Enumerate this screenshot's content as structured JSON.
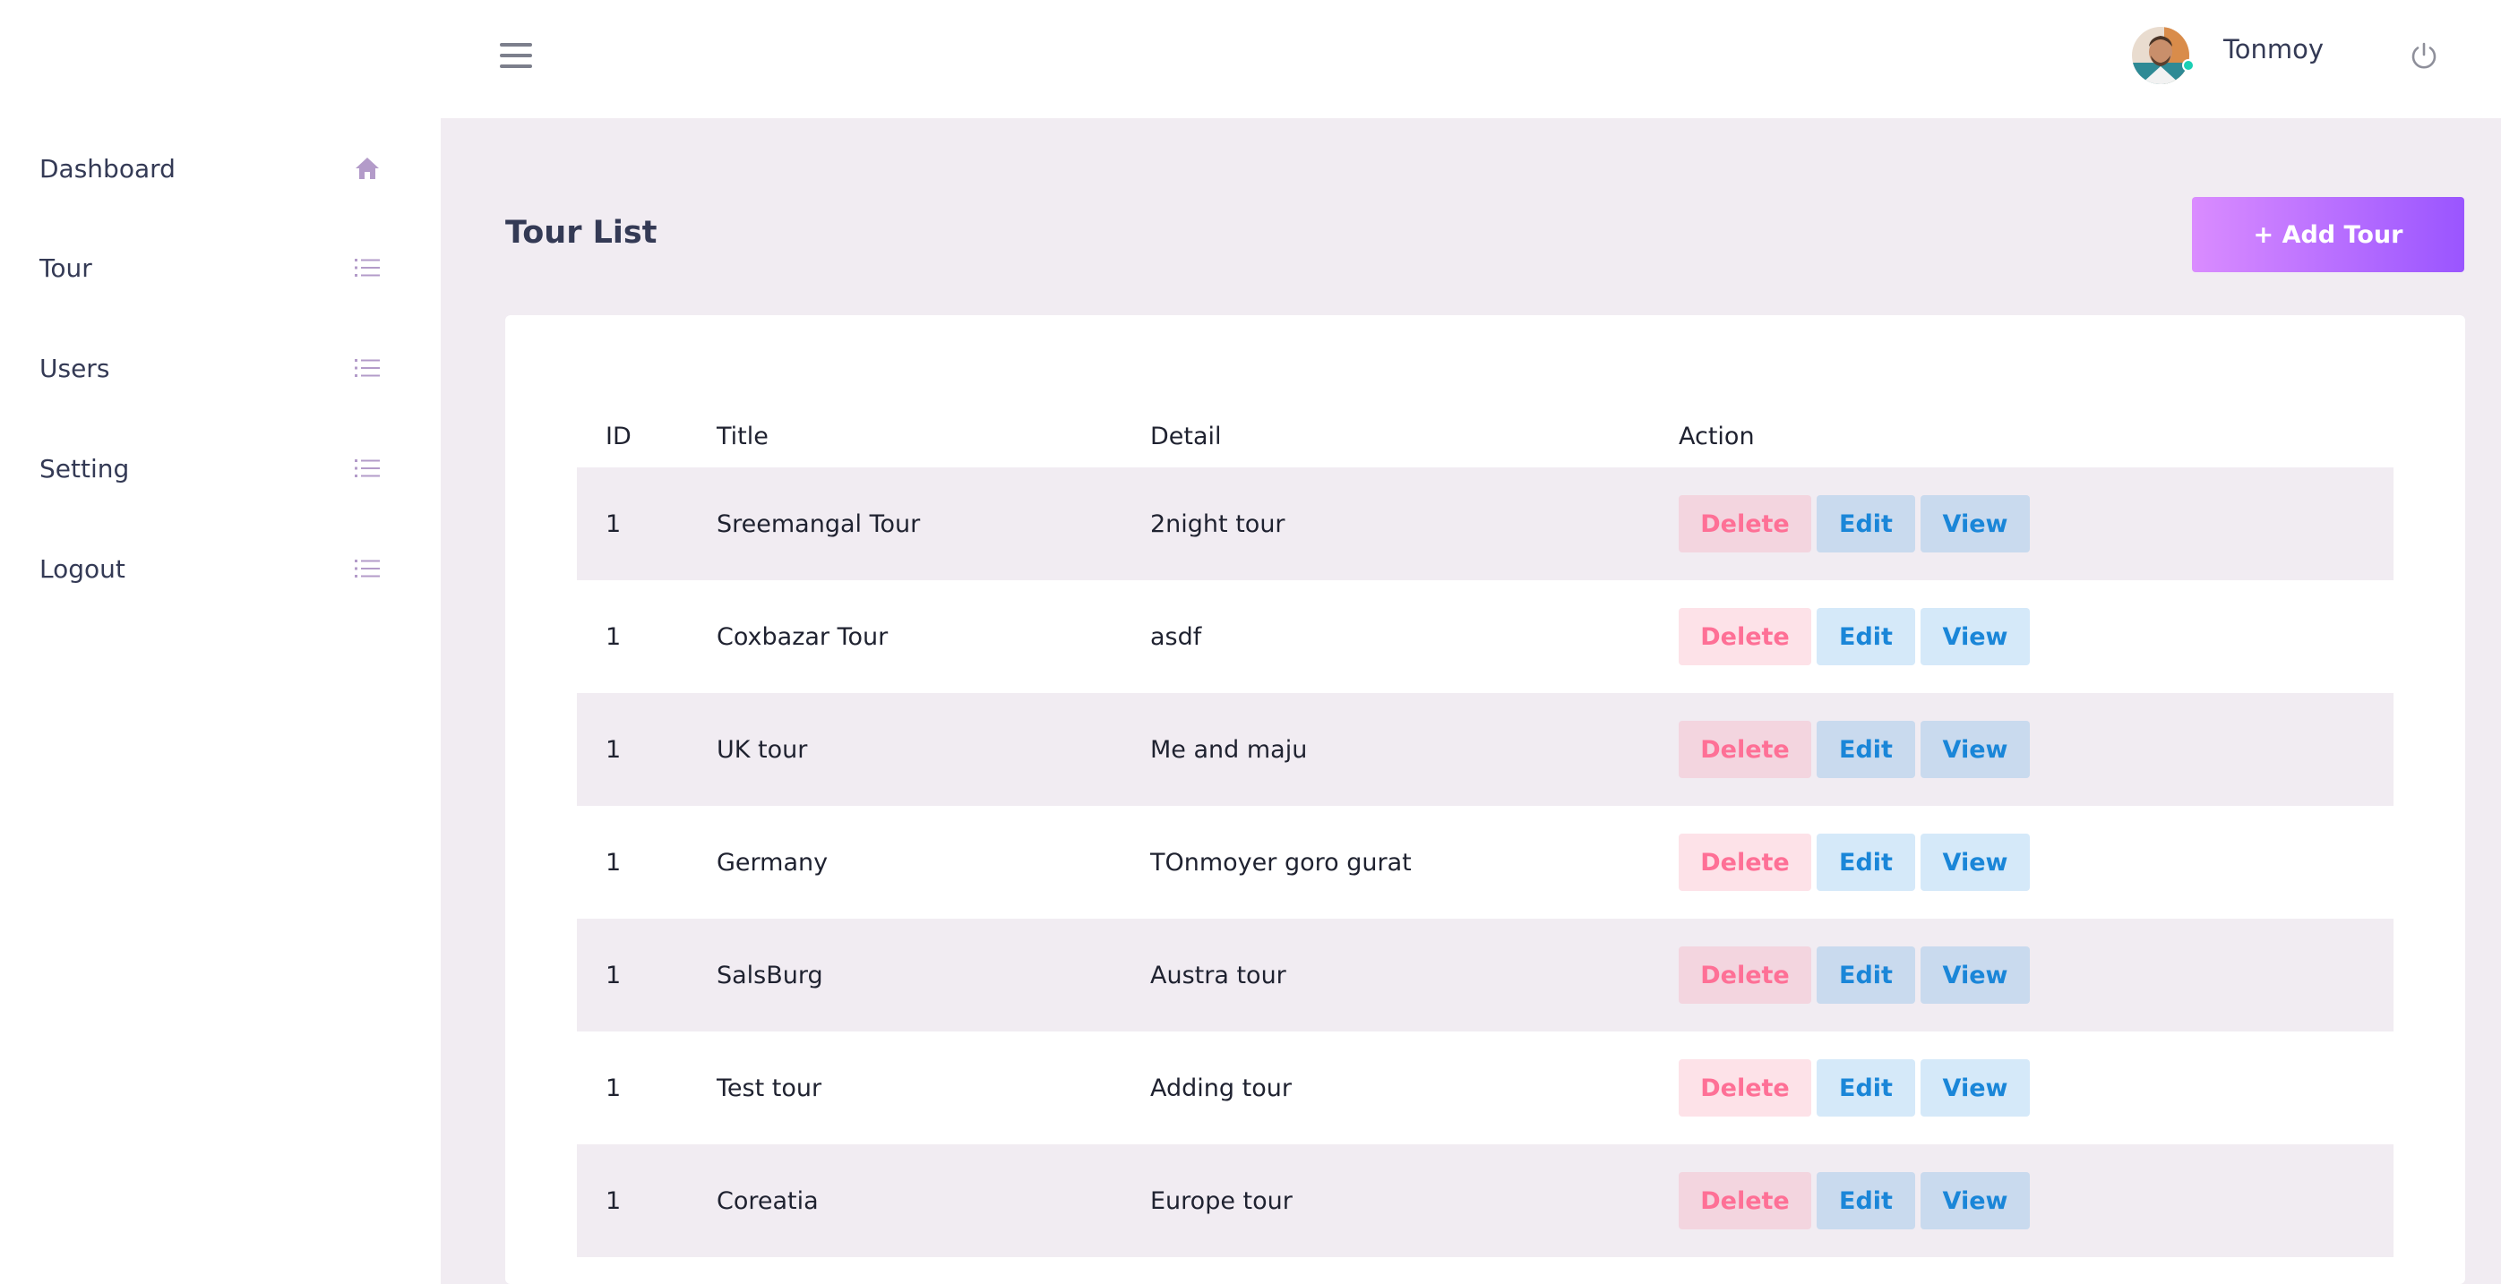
{
  "sidebar": {
    "items": [
      {
        "label": "Dashboard",
        "icon": "home-icon"
      },
      {
        "label": "Tour",
        "icon": "list-icon"
      },
      {
        "label": "Users",
        "icon": "list-icon"
      },
      {
        "label": "Setting",
        "icon": "list-icon"
      },
      {
        "label": "Logout",
        "icon": "list-icon"
      }
    ]
  },
  "topbar": {
    "user_name": "Tonmoy",
    "status_color": "#1bcfb4"
  },
  "page": {
    "title": "Tour List",
    "add_button_label": "+ Add Tour"
  },
  "table": {
    "headers": {
      "id": "ID",
      "title": "Title",
      "detail": "Detail",
      "action": "Action"
    },
    "action_labels": {
      "delete": "Delete",
      "edit": "Edit",
      "view": "View"
    },
    "rows": [
      {
        "id": "1",
        "title": "Sreemangal Tour",
        "detail": "2night tour"
      },
      {
        "id": "1",
        "title": "Coxbazar Tour",
        "detail": "asdf"
      },
      {
        "id": "1",
        "title": "UK tour",
        "detail": "Me and maju"
      },
      {
        "id": "1",
        "title": "Germany",
        "detail": "TOnmoyer goro gurat"
      },
      {
        "id": "1",
        "title": "SalsBurg",
        "detail": "Austra tour"
      },
      {
        "id": "1",
        "title": "Test tour",
        "detail": "Adding tour"
      },
      {
        "id": "1",
        "title": "Coreatia",
        "detail": "Europe tour"
      }
    ]
  },
  "colors": {
    "accent_gradient_start": "#da8cff",
    "accent_gradient_end": "#9a55ff",
    "delete": "#fe7096",
    "edit_view": "#1a86d8",
    "content_bg": "#f1ecf2"
  }
}
